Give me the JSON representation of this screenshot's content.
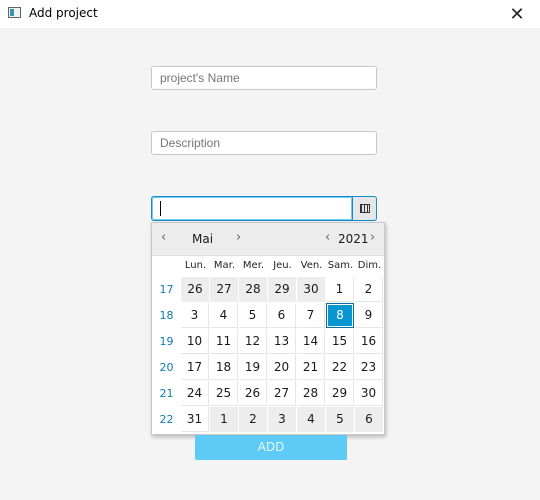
{
  "window": {
    "title": "Add project",
    "close_symbol": "✕"
  },
  "form": {
    "name_placeholder": "project's Name",
    "description_placeholder": "Description",
    "date_value": "",
    "add_label": "ADD"
  },
  "calendar": {
    "month": "Mai",
    "year": "2021",
    "prev_symbol": "‹",
    "next_symbol": "›",
    "weekdays": [
      "Lun.",
      "Mar.",
      "Mer.",
      "Jeu.",
      "Ven.",
      "Sam.",
      "Dim."
    ],
    "weeks": [
      {
        "num": "17",
        "days": [
          {
            "d": "26",
            "cur": false
          },
          {
            "d": "27",
            "cur": false
          },
          {
            "d": "28",
            "cur": false
          },
          {
            "d": "29",
            "cur": false
          },
          {
            "d": "30",
            "cur": false
          },
          {
            "d": "1",
            "cur": true
          },
          {
            "d": "2",
            "cur": true
          }
        ]
      },
      {
        "num": "18",
        "days": [
          {
            "d": "3",
            "cur": true
          },
          {
            "d": "4",
            "cur": true
          },
          {
            "d": "5",
            "cur": true
          },
          {
            "d": "6",
            "cur": true
          },
          {
            "d": "7",
            "cur": true
          },
          {
            "d": "8",
            "cur": true,
            "selected": true
          },
          {
            "d": "9",
            "cur": true
          }
        ]
      },
      {
        "num": "19",
        "days": [
          {
            "d": "10",
            "cur": true
          },
          {
            "d": "11",
            "cur": true
          },
          {
            "d": "12",
            "cur": true
          },
          {
            "d": "13",
            "cur": true
          },
          {
            "d": "14",
            "cur": true
          },
          {
            "d": "15",
            "cur": true
          },
          {
            "d": "16",
            "cur": true
          }
        ]
      },
      {
        "num": "20",
        "days": [
          {
            "d": "17",
            "cur": true
          },
          {
            "d": "18",
            "cur": true
          },
          {
            "d": "19",
            "cur": true
          },
          {
            "d": "20",
            "cur": true
          },
          {
            "d": "21",
            "cur": true
          },
          {
            "d": "22",
            "cur": true
          },
          {
            "d": "23",
            "cur": true
          }
        ]
      },
      {
        "num": "21",
        "days": [
          {
            "d": "24",
            "cur": true
          },
          {
            "d": "25",
            "cur": true
          },
          {
            "d": "26",
            "cur": true
          },
          {
            "d": "27",
            "cur": true
          },
          {
            "d": "28",
            "cur": true
          },
          {
            "d": "29",
            "cur": true
          },
          {
            "d": "30",
            "cur": true
          }
        ]
      },
      {
        "num": "22",
        "days": [
          {
            "d": "31",
            "cur": true
          },
          {
            "d": "1",
            "cur": false
          },
          {
            "d": "2",
            "cur": false
          },
          {
            "d": "3",
            "cur": false
          },
          {
            "d": "4",
            "cur": false
          },
          {
            "d": "5",
            "cur": false
          },
          {
            "d": "6",
            "cur": false
          }
        ]
      }
    ]
  },
  "colors": {
    "accent": "#0896d0",
    "week_number": "#0f7ab0",
    "add_button": "#5ecbf6"
  }
}
